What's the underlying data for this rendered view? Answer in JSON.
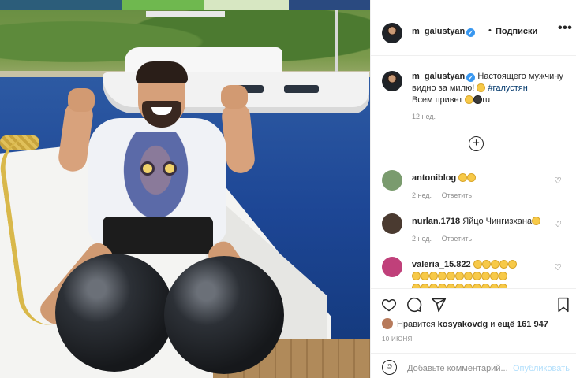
{
  "post": {
    "author": "m_galustyan",
    "follow_label": "Подписки",
    "more_label": "•••"
  },
  "caption": {
    "author": "m_galustyan",
    "text_part1": "Настоящего мужчину видно за милю! ",
    "hashtag": "#галустян",
    "text_part2": "Всем привет ",
    "suffix": "ru",
    "time": "12 нед."
  },
  "comments": [
    {
      "user": "antoniblog",
      "text": "",
      "time": "2 нед.",
      "reply": "Ответить",
      "avatar_color": "#7a9b6e"
    },
    {
      "user": "nurlan.1718",
      "text": "Яйцо Чингизхана",
      "time": "2 нед.",
      "reply": "Ответить",
      "avatar_color": "#4a3a30"
    },
    {
      "user": "valeria_15.822",
      "text": "",
      "time": "",
      "reply": "",
      "avatar_color": "#c0407a"
    }
  ],
  "likes": {
    "prefix": "Нравится",
    "user": "kosyakovdg",
    "middle": "и",
    "count_text": "ещё 161 947"
  },
  "date": "10 ИЮНЯ",
  "add_comment": {
    "placeholder": "Добавьте комментарий...",
    "publish": "Опубликовать"
  },
  "icons": {
    "like": "heart-icon",
    "comment": "comment-icon",
    "share": "paper-plane-icon",
    "save": "bookmark-icon",
    "emoji": "smiley-icon",
    "add": "plus-circle-icon"
  },
  "colors": {
    "link": "#00376b",
    "verified": "#3897f0",
    "muted": "#8e8e8e",
    "publish": "#b2dffc"
  }
}
